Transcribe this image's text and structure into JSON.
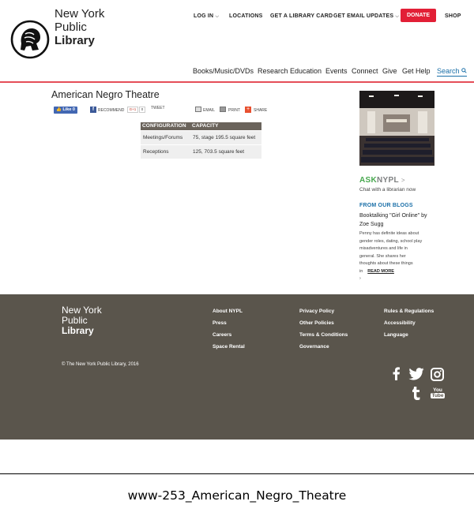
{
  "header": {
    "logo_lines": [
      "New York",
      "Public",
      "Library"
    ],
    "top_nav": {
      "log_in": "LOG IN",
      "locations": "LOCATIONS",
      "library_card": "GET A LIBRARY CARD",
      "email_updates": "GET EMAIL UPDATES",
      "donate": "DONATE",
      "shop": "SHOP"
    },
    "main_nav": [
      "Books/Music/DVDs",
      "Research",
      "Education",
      "Events",
      "Connect",
      "Give",
      "Get Help"
    ],
    "search_label": "Search",
    "colors": {
      "donate": "#e21f36",
      "accent_line": "#e54e58",
      "link": "#1a6fa8"
    }
  },
  "page": {
    "title": "American Negro Theatre",
    "share": {
      "like": "Like 0",
      "recommend": "RECOMMEND",
      "gplus": "G+1",
      "gplus_count": "0",
      "tweet": "TWEET",
      "email": "EMAIL",
      "print": "PRINT",
      "share": "SHARE"
    },
    "table": {
      "headers": [
        "CONFIGURATION",
        "CAPACITY"
      ],
      "rows": [
        [
          "Meetings/Forums",
          "75, stage 195.5 square feet"
        ],
        [
          "Receptions",
          "125, 703.5 square feet"
        ]
      ]
    }
  },
  "sidebar": {
    "ask_a": "ASK",
    "ask_b": "NYPL",
    "ask_arrow": ">",
    "ask_sub": "Chat with a librarian now",
    "blogs_heading": "FROM OUR BLOGS",
    "blog_title": "Booktalking \"Girl Online\" by Zoe Sugg",
    "blog_body": "Penny has definite ideas about gender roles, dating, school play misadventures and life in general. She shares her thoughts about these things in",
    "read_more": "READ MORE",
    "trailing": "›"
  },
  "footer": {
    "logo_lines": [
      "New York",
      "Public",
      "Library"
    ],
    "col1": [
      "About NYPL",
      "Press",
      "Careers",
      "Space Rental"
    ],
    "col2": [
      "Privacy Policy",
      "Other Policies",
      "Terms & Conditions",
      "Governance"
    ],
    "col3": [
      "Rules & Regulations",
      "Accessibility",
      "Language"
    ],
    "copyright": "© The New York Public Library, 2016",
    "social_icons": [
      "facebook-icon",
      "twitter-icon",
      "instagram-icon",
      "tumblr-icon",
      "youtube-icon"
    ],
    "youtube_top": "You",
    "youtube_bottom": "Tube",
    "background": "#5a554c"
  },
  "caption": "www-253_American_Negro_Theatre"
}
